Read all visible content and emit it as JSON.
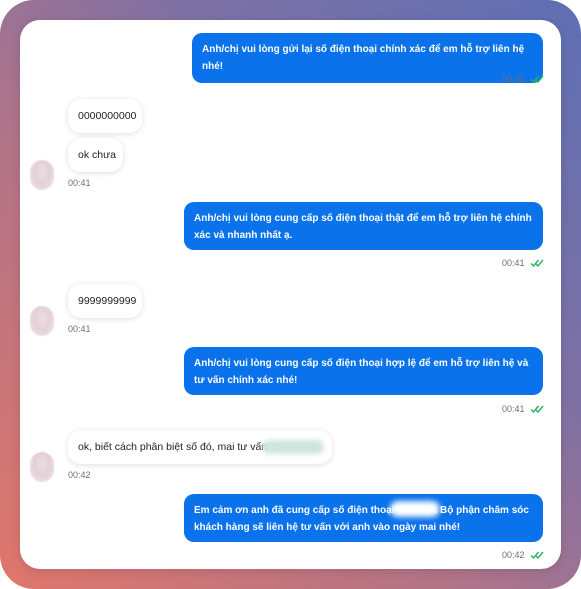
{
  "messages": [
    {
      "direction": "out",
      "text": "Anh/chị vui lòng gửi lại số điện thoại chính xác để em hỗ trợ liên hệ nhé!",
      "time": "00:41",
      "status": "read"
    },
    {
      "direction": "in",
      "text": "0000000000"
    },
    {
      "direction": "in",
      "text": "ok chưa",
      "time": "00:41"
    },
    {
      "direction": "out",
      "text": "Anh/chị vui lòng cung cấp số điện thoại thật để em hỗ trợ liên hệ chính xác và nhanh nhất ạ.",
      "time": "00:41",
      "status": "read"
    },
    {
      "direction": "in",
      "text": "9999999999",
      "time": "00:41"
    },
    {
      "direction": "out",
      "text": "Anh/chị vui lòng cung cấp số điện thoại hợp lệ để em hỗ trợ liên hệ và tư vấn chính xác nhé!",
      "time": "00:41",
      "status": "read"
    },
    {
      "direction": "in",
      "text": "ok, biết cách phân biệt số đó, mai tư vấn a",
      "time": "00:42"
    },
    {
      "direction": "out",
      "text_part1": "Em cảm ơn anh đã cung cấp số điện thoại",
      "text_part2": ". Bộ phận chăm sóc khách hàng sẽ liên hệ tư vấn với anh vào ngày mai nhé!",
      "time": "00:42",
      "status": "read"
    }
  ],
  "colors": {
    "outgoing_bubble": "#0a72ea",
    "read_check": "#22b35c"
  },
  "icons": {
    "read_receipt": "double-check-icon",
    "avatar": "blurred-avatar"
  }
}
